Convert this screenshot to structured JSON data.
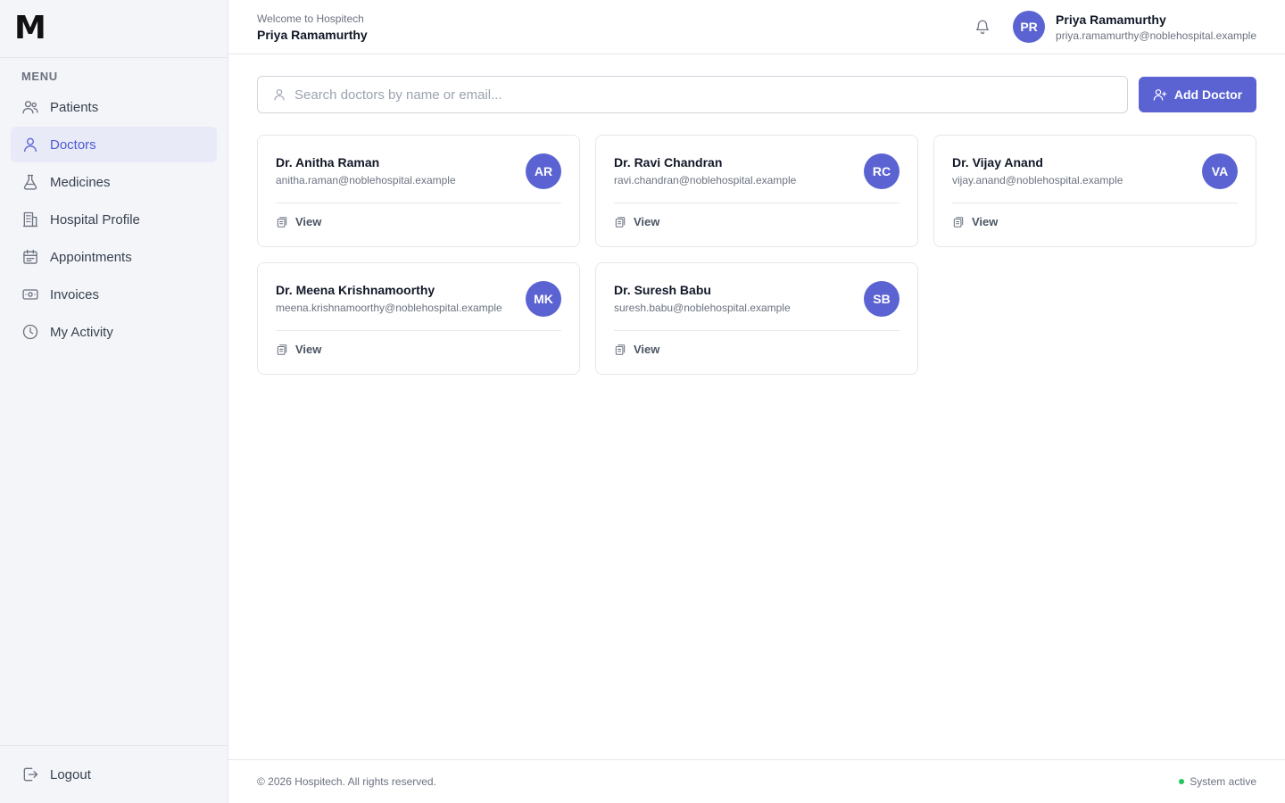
{
  "app": {
    "logo": "M",
    "menu_title": "MENU"
  },
  "sidebar": {
    "items": [
      {
        "label": "Patients",
        "icon": "users-icon"
      },
      {
        "label": "Doctors",
        "icon": "user-icon",
        "active": true
      },
      {
        "label": "Medicines",
        "icon": "flask-icon"
      },
      {
        "label": "Hospital Profile",
        "icon": "building-icon"
      },
      {
        "label": "Appointments",
        "icon": "calendar-icon"
      },
      {
        "label": "Invoices",
        "icon": "banknote-icon"
      },
      {
        "label": "My Activity",
        "icon": "clock-icon"
      }
    ],
    "logout_label": "Logout"
  },
  "header": {
    "welcome": "Welcome to Hospitech",
    "name": "Priya Ramamurthy",
    "user": {
      "initials": "PR",
      "name": "Priya Ramamurthy",
      "email": "priya.ramamurthy@noblehospital.example"
    }
  },
  "search": {
    "placeholder": "Search doctors by name or email...",
    "value": ""
  },
  "add_button": {
    "label": "Add Doctor"
  },
  "doctors": [
    {
      "name": "Dr. Anitha Raman",
      "email": "anitha.raman@noblehospital.example",
      "initials": "AR",
      "action": "View"
    },
    {
      "name": "Dr. Ravi Chandran",
      "email": "ravi.chandran@noblehospital.example",
      "initials": "RC",
      "action": "View"
    },
    {
      "name": "Dr. Vijay Anand",
      "email": "vijay.anand@noblehospital.example",
      "initials": "VA",
      "action": "View"
    },
    {
      "name": "Dr. Meena Krishnamoorthy",
      "email": "meena.krishnamoorthy@noblehospital.example",
      "initials": "MK",
      "action": "View"
    },
    {
      "name": "Dr. Suresh Babu",
      "email": "suresh.babu@noblehospital.example",
      "initials": "SB",
      "action": "View"
    }
  ],
  "footer": {
    "copyright": "© 2026 Hospitech. All rights reserved.",
    "status": "System active"
  },
  "colors": {
    "accent": "#5b63d3",
    "status_green": "#22c55e",
    "active_bg": "#e8eaf7"
  }
}
